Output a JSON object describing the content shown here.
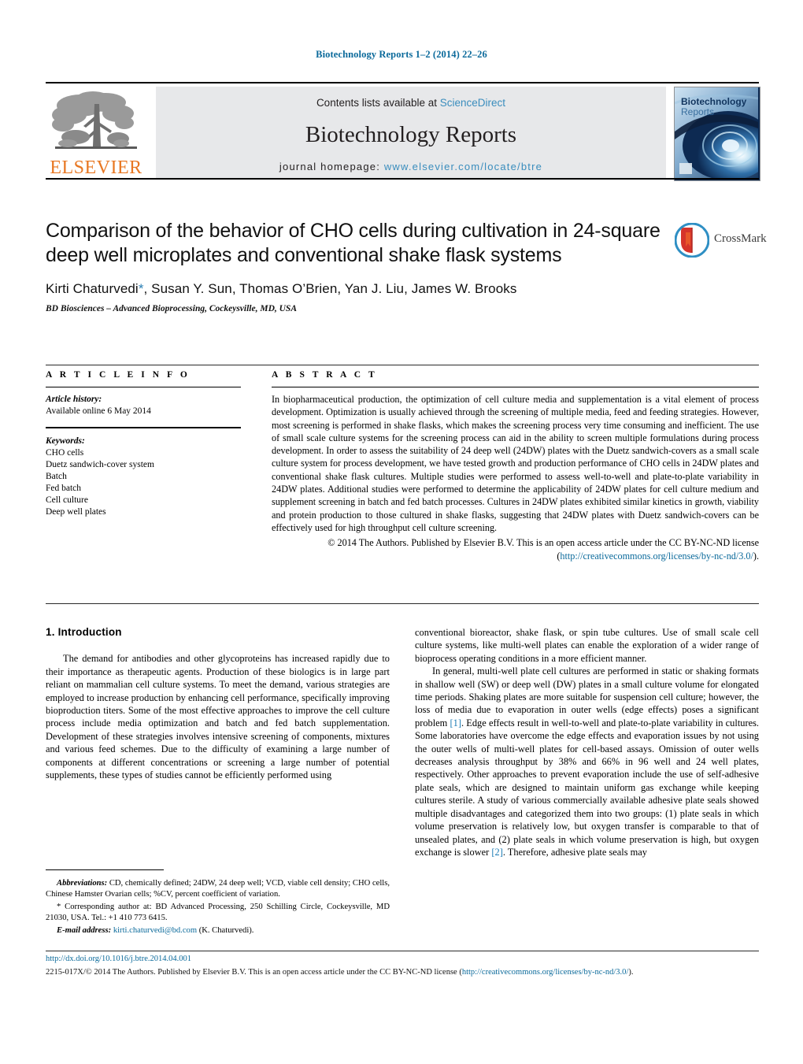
{
  "running_head": "Biotechnology Reports 1–2 (2014) 22–26",
  "masthead": {
    "publisher_name": "ELSEVIER",
    "contents_prefix": "Contents lists available at ",
    "contents_link": "ScienceDirect",
    "journal_title": "Biotechnology Reports",
    "homepage_prefix": "journal homepage: ",
    "homepage_url": "www.elsevier.com/locate/btre",
    "cover_title_line1": "Biotechnology",
    "cover_title_line2": "Reports"
  },
  "article": {
    "title": "Comparison of the behavior of CHO cells during cultivation in 24-square deep well microplates and conventional shake flask systems",
    "authors_pre": "Kirti Chaturvedi",
    "authors_star": "*",
    "authors_post": ", Susan Y. Sun, Thomas O’Brien, Yan J. Liu, James W. Brooks",
    "affiliation": "BD Biosciences – Advanced Bioprocessing, Cockeysville, MD, USA",
    "crossmark_label": "CrossMark"
  },
  "article_info": {
    "heading": "A R T I C L E   I N F O",
    "history_label": "Article history:",
    "history_value": "Available online 6 May 2014",
    "keywords_label": "Keywords:",
    "keywords": [
      "CHO cells",
      "Duetz sandwich-cover system",
      "Batch",
      "Fed batch",
      "Cell culture",
      "Deep well plates"
    ]
  },
  "abstract": {
    "heading": "A B S T R A C T",
    "body": "In biopharmaceutical production, the optimization of cell culture media and supplementation is a vital element of process development. Optimization is usually achieved through the screening of multiple media, feed and feeding strategies. However, most screening is performed in shake flasks, which makes the screening process very time consuming and inefficient. The use of small scale culture systems for the screening process can aid in the ability to screen multiple formulations during process development. In order to assess the suitability of 24 deep well (24DW) plates with the Duetz sandwich-covers as a small scale culture system for process development, we have tested growth and production performance of CHO cells in 24DW plates and conventional shake flask cultures. Multiple studies were performed to assess well-to-well and plate-to-plate variability in 24DW plates. Additional studies were performed to determine the applicability of 24DW plates for cell culture medium and supplement screening in batch and fed batch processes. Cultures in 24DW plates exhibited similar kinetics in growth, viability and protein production to those cultured in shake flasks, suggesting that 24DW plates with Duetz sandwich-covers can be effectively used for high throughput cell culture screening.",
    "copyright_pre": "© 2014 The Authors. Published by Elsevier B.V. This is an open access article under the CC BY-NC-ND license (",
    "copyright_link": "http://creativecommons.org/licenses/by-nc-nd/3.0/",
    "copyright_post": ")."
  },
  "body": {
    "section_number_title": "1.  Introduction",
    "left_paragraph_1": "The demand for antibodies and other glycoproteins has increased rapidly due to their importance as therapeutic agents. Production of these biologics is in large part reliant on mammalian cell culture systems. To meet the demand, various strategies are employed to increase production by enhancing cell performance, specifically improving bioproduction titers. Some of the most effective approaches to improve the cell culture process include media optimization and batch and fed batch supplementation. Development of these strategies involves intensive screening of components, mixtures and various feed schemes. Due to the difficulty of examining a large number of components at different concentrations or screening a large number of potential supplements, these types of studies cannot be efficiently performed using",
    "right_paragraph_1": "conventional bioreactor, shake flask, or spin tube cultures. Use of small scale cell culture systems, like multi-well plates can enable the exploration of a wider range of bioprocess operating conditions in a more efficient manner.",
    "right_paragraph_2_a": "In general, multi-well plate cell cultures are performed in static or shaking formats in shallow well (SW) or deep well (DW) plates in a small culture volume for elongated time periods. Shaking plates are more suitable for suspension cell culture; however, the loss of media due to evaporation in outer wells (edge effects) poses a significant problem ",
    "right_cite_1": "[1]",
    "right_paragraph_2_b": ". Edge effects result in well-to-well and plate-to-plate variability in cultures. Some laboratories have overcome the edge effects and evaporation issues by not using the outer wells of multi-well plates for cell-based assays. Omission of outer wells decreases analysis throughput by 38% and 66% in 96 well and 24 well plates, respectively. Other approaches to prevent evaporation include the use of self-adhesive plate seals, which are designed to maintain uniform gas exchange while keeping cultures sterile. A study of various commercially available adhesive plate seals showed multiple disadvantages and categorized them into two groups: (1) plate seals in which volume preservation is relatively low, but oxygen transfer is comparable to that of unsealed plates, and (2) plate seals in which volume preservation is high, but oxygen exchange is slower ",
    "right_cite_2": "[2]",
    "right_paragraph_2_c": ". Therefore, adhesive plate seals may"
  },
  "footnotes": {
    "abbreviations_label": "Abbreviations:",
    "abbreviations_text": " CD, chemically defined; 24DW, 24 deep well; VCD, viable cell density; CHO cells, Chinese Hamster Ovarian cells; %CV, percent coefficient of variation.",
    "corresponding_star": "*",
    "corresponding_text": " Corresponding author at: BD Advanced Processing, 250 Schilling Circle, Cockeysville, MD 21030, USA. Tel.: +1 410 773 6415.",
    "email_label": "E-mail address:",
    "email_value": "kirti.chaturvedi@bd.com",
    "email_owner": " (K. Chaturvedi)."
  },
  "footer": {
    "doi": "http://dx.doi.org/10.1016/j.btre.2014.04.001",
    "issn_pre": "2215-017X/© 2014 The Authors. Published by Elsevier B.V. This is an open access article under the CC BY-NC-ND license (",
    "issn_link": "http://creativecommons.org/licenses/by-nc-nd/3.0/",
    "issn_post": ")."
  },
  "colors": {
    "link": "#0b6a9b",
    "sciencedirect": "#3a8dbd",
    "elsevier_orange": "#e87722",
    "banner_bg": "#e7e8ea"
  }
}
